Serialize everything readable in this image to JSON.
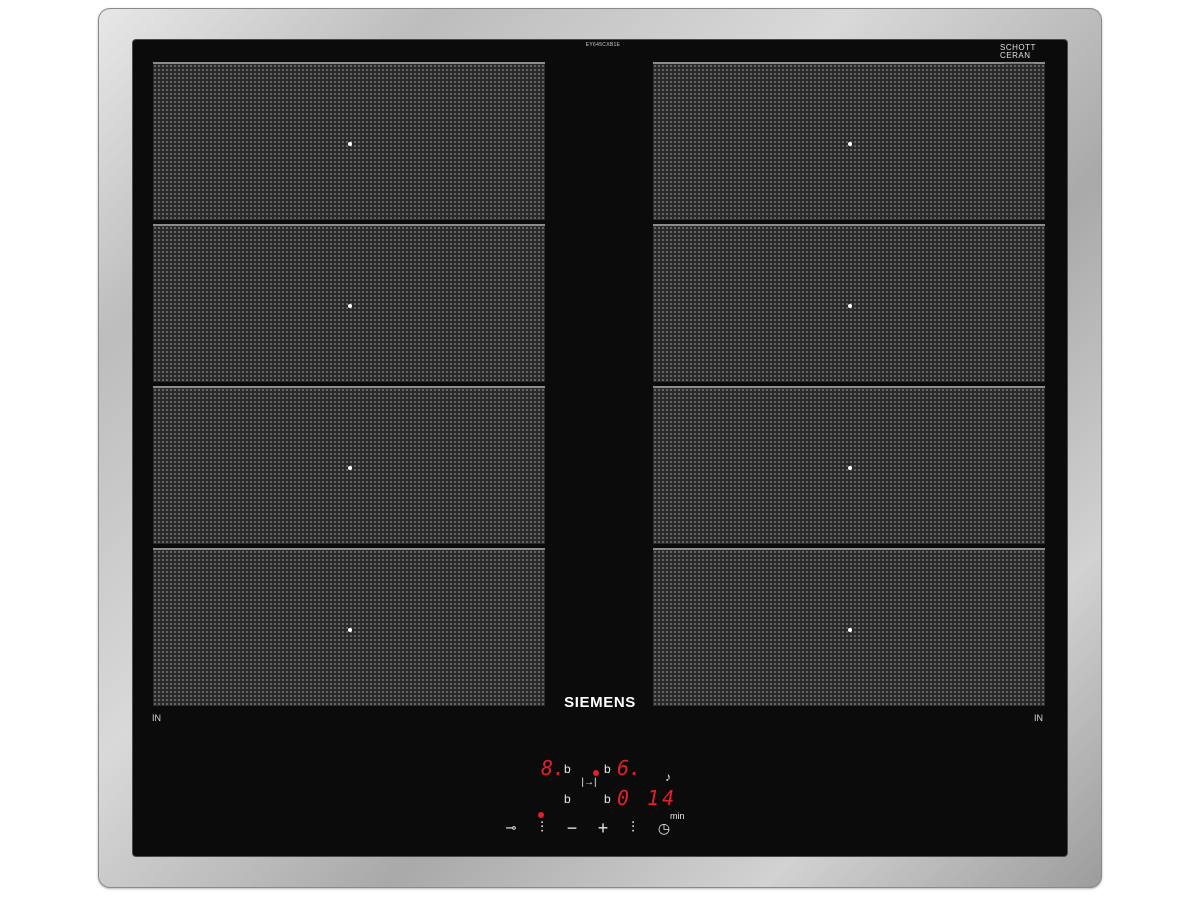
{
  "model_number": "EY645CXB1E",
  "logo_schott": [
    "SCHOTT",
    "CERAN"
  ],
  "brand": "SIEMENS",
  "zone_label_left": "IN",
  "zone_label_right": "IN",
  "display": {
    "left_power": "8.",
    "right_power": "6.",
    "timer": "0 14",
    "timer_unit": "min",
    "left_indicator": "b",
    "right_indicator": "b",
    "left_indicator_2": "b",
    "right_indicator_2": "b"
  },
  "controls": {
    "minus": "−",
    "plus": "+",
    "sync": "|→|",
    "bell": "bell-icon",
    "clock": "clock-icon",
    "key": "key-icon",
    "left_select": "select-left-icon",
    "right_select": "select-right-icon"
  },
  "colors": {
    "display_red": "#e0202a",
    "glass": "#0b0b0b",
    "frame": "#bdbdbd"
  }
}
